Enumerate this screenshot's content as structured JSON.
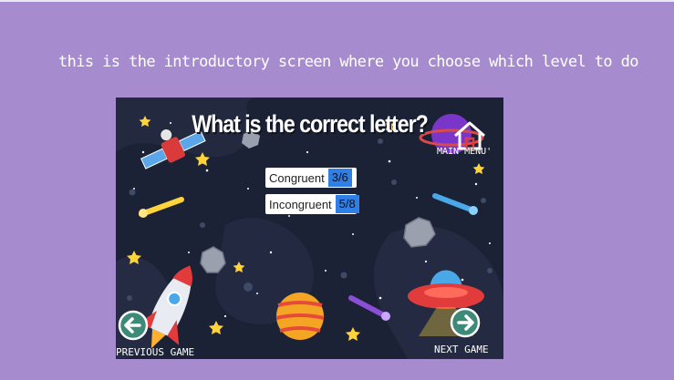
{
  "caption": "this is the introductory screen where you choose which level to do",
  "game": {
    "title": "What is the correct letter?",
    "main_menu_label": "MAIN MENU'",
    "scores": [
      {
        "label": "Congruent",
        "value": "3/6"
      },
      {
        "label": "Incongruent",
        "value": "5/8"
      }
    ],
    "prev_label": "PREVIOUS GAME",
    "next_label": "NEXT GAME"
  },
  "icons": {
    "home": "home-icon",
    "prev": "arrow-left-icon",
    "next": "arrow-right-icon"
  },
  "colors": {
    "page_background": "#a78bcf",
    "game_background": "#1c2236",
    "score_badge": "#2f7fe6",
    "nav_button": "#3d8a78"
  }
}
